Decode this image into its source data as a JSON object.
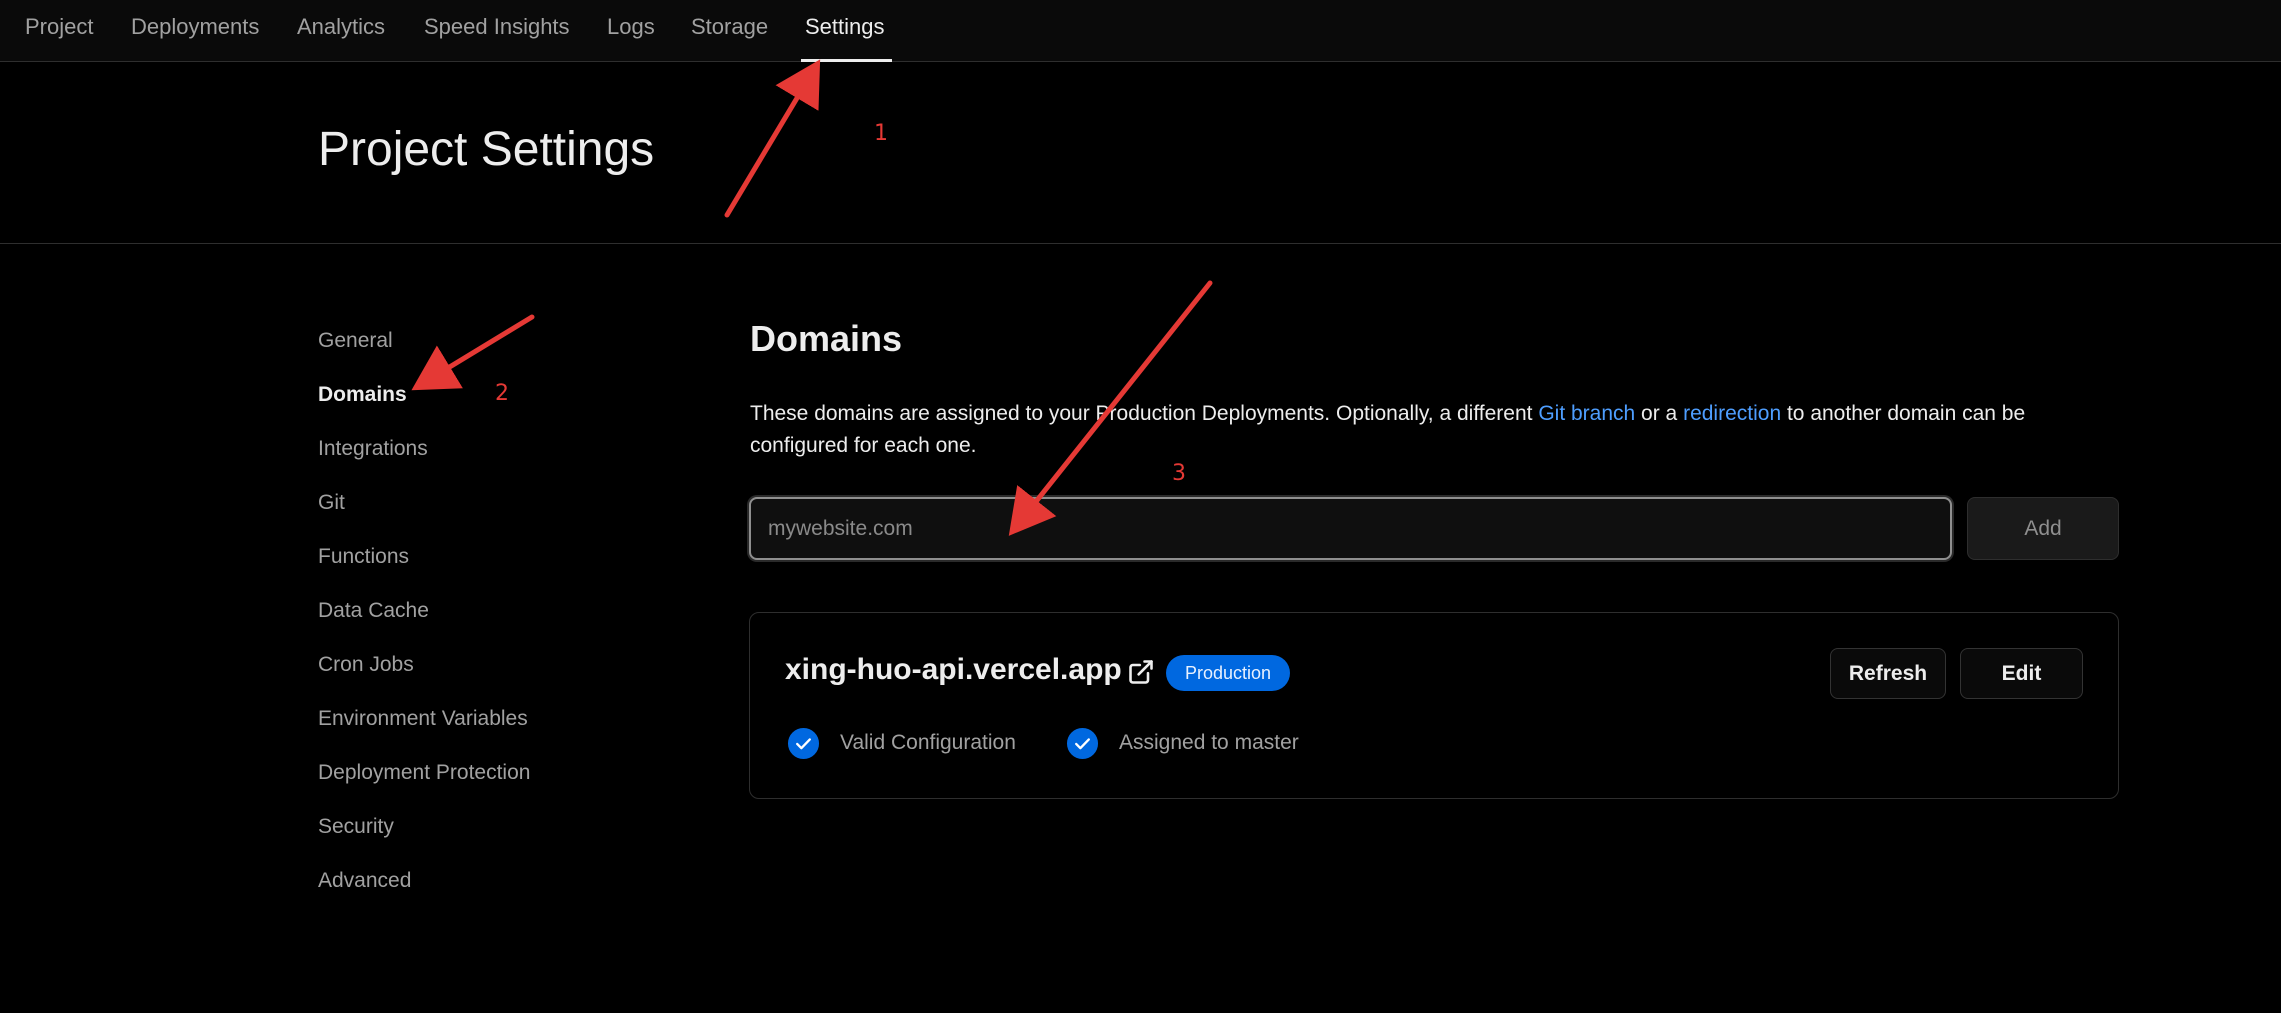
{
  "nav": {
    "tabs": [
      {
        "label": "Project"
      },
      {
        "label": "Deployments"
      },
      {
        "label": "Analytics"
      },
      {
        "label": "Speed Insights"
      },
      {
        "label": "Logs"
      },
      {
        "label": "Storage"
      },
      {
        "label": "Settings",
        "active": true
      }
    ]
  },
  "header": {
    "title": "Project Settings"
  },
  "sidebar": {
    "items": [
      {
        "label": "General"
      },
      {
        "label": "Domains",
        "active": true
      },
      {
        "label": "Integrations"
      },
      {
        "label": "Git"
      },
      {
        "label": "Functions"
      },
      {
        "label": "Data Cache"
      },
      {
        "label": "Cron Jobs"
      },
      {
        "label": "Environment Variables"
      },
      {
        "label": "Deployment Protection"
      },
      {
        "label": "Security"
      },
      {
        "label": "Advanced"
      }
    ]
  },
  "domains": {
    "title": "Domains",
    "description_part1": "These domains are assigned to your Production Deployments. Optionally, a different ",
    "git_branch_link": "Git branch",
    "description_part2": " or a ",
    "redirection_link": "redirection",
    "description_part3": " to another domain can be configured for each one.",
    "input_placeholder": "mywebsite.com",
    "input_value": "",
    "add_label": "Add",
    "card": {
      "domain": "xing-huo-api.vercel.app",
      "badge": "Production",
      "refresh_label": "Refresh",
      "edit_label": "Edit",
      "status_valid": "Valid Configuration",
      "status_assigned": "Assigned to master"
    }
  },
  "annotations": {
    "one": "1",
    "two": "2",
    "three": "3"
  },
  "colors": {
    "background": "#000000",
    "accent_blue": "#0068e0",
    "link_blue": "#4e9eff",
    "annotation_red": "#e53935"
  }
}
